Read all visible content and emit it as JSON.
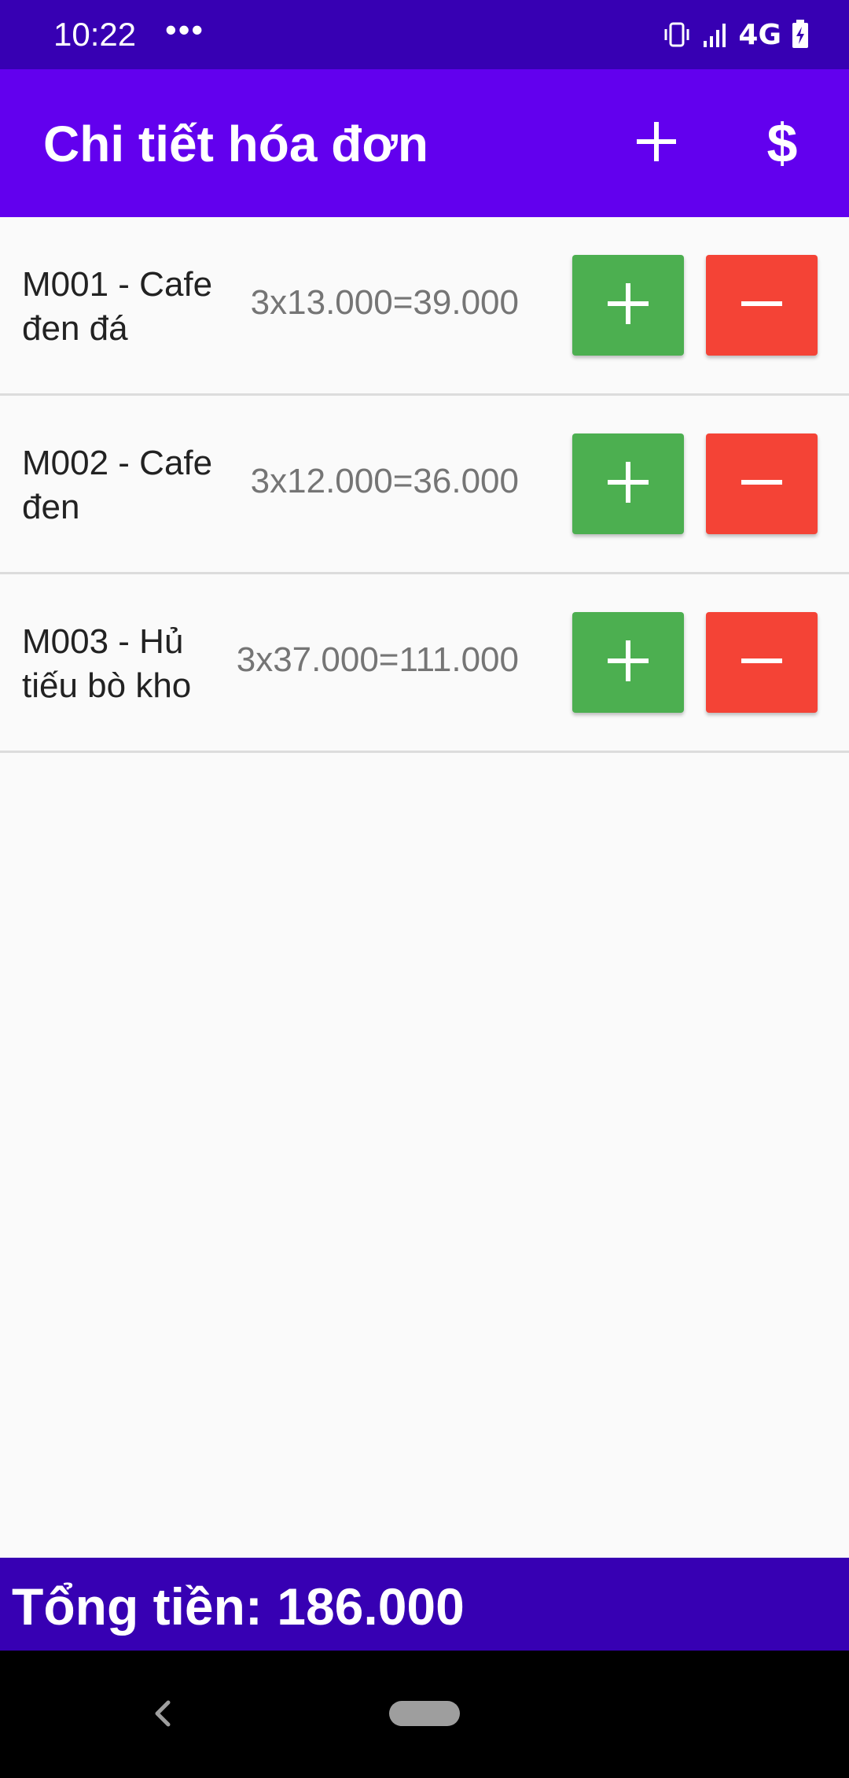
{
  "status_bar": {
    "time": "10:22",
    "dots": "•••",
    "network": "4G",
    "icons": [
      "vibrate-icon",
      "signal-icon",
      "battery-icon"
    ]
  },
  "app_bar": {
    "title": "Chi tiết hóa đơn",
    "actions": [
      "add-icon",
      "dollar-icon"
    ],
    "pay_symbol": "$"
  },
  "items": [
    {
      "name": "M001 - Cafe đen đá",
      "calc": "3x13.000=39.000"
    },
    {
      "name": "M002 - Cafe đen",
      "calc": "3x12.000=36.000"
    },
    {
      "name": "M003 - Hủ tiếu bò kho",
      "calc": "3x37.000=111.000"
    }
  ],
  "total": {
    "text": "Tổng tiền: 186.000"
  },
  "colors": {
    "status_bar": "#3700b3",
    "app_bar": "#6200ee",
    "increase_button": "#4caf50",
    "decrease_button": "#f44336",
    "total_bar": "#3700b3"
  }
}
